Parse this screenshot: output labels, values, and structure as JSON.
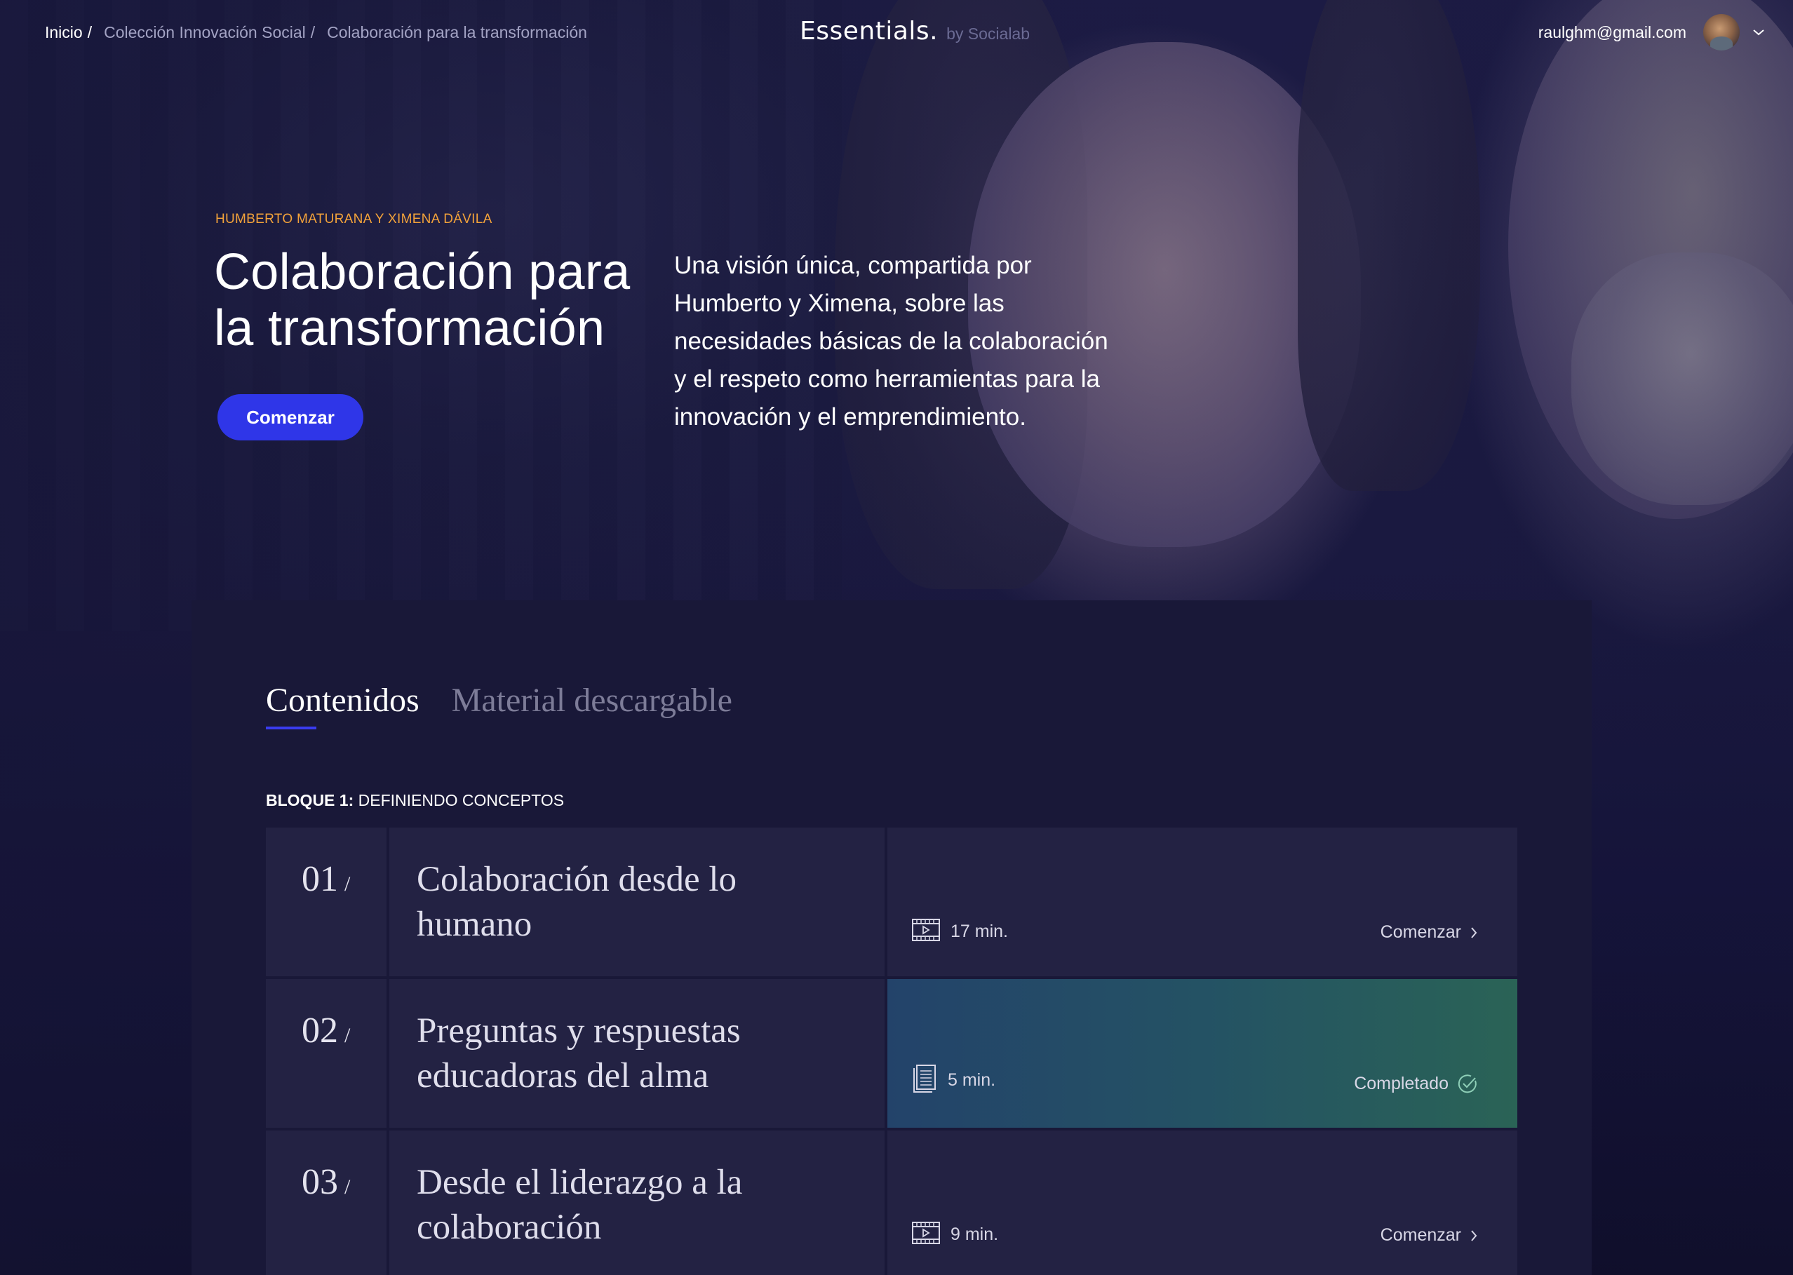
{
  "breadcrumb": {
    "items": [
      {
        "label": "Inicio"
      },
      {
        "label": "Colección Innovación Social"
      },
      {
        "label": "Colaboración para la transformación"
      }
    ],
    "separator": "/"
  },
  "brand": {
    "logo": "Essentials.",
    "byline": "by Socialab"
  },
  "user": {
    "email": "raulghm@gmail.com",
    "avatar_icon": "user-avatar",
    "menu_icon": "chevron-down-icon"
  },
  "hero": {
    "authors": "HUMBERTO MATURANA Y XIMENA DÁVILA",
    "title": "Colaboración para la transformación",
    "cta_label": "Comenzar",
    "description": "Una visión única, compartida por Humberto y Ximena, sobre las necesidades básicas de la colaboración y el respeto como herramientas para la innovación y el emprendimiento."
  },
  "tabs": [
    {
      "label": "Contenidos",
      "active": true
    },
    {
      "label": "Material descargable",
      "active": false
    }
  ],
  "block": {
    "prefix": "BLOQUE 1:",
    "name": "DEFINIENDO CONCEPTOS"
  },
  "lessons": [
    {
      "number": "01",
      "title": "Colaboración desde lo humano",
      "type_icon": "video-icon",
      "duration": "17 min.",
      "action": "Comenzar",
      "action_icon": "chevron-right-icon",
      "completed": false
    },
    {
      "number": "02",
      "title": "Preguntas y respuestas educadoras del alma",
      "type_icon": "document-icon",
      "duration": "5 min.",
      "action": "Completado",
      "action_icon": "check-circle-icon",
      "completed": true
    },
    {
      "number": "03",
      "title": "Desde el liderazgo a la colaboración",
      "type_icon": "video-icon",
      "duration": "9 min.",
      "action": "Comenzar",
      "action_icon": "chevron-right-icon",
      "completed": false
    }
  ],
  "colors": {
    "accent": "#2f36e8",
    "authors": "#f2a23a",
    "completed_start": "#23436a",
    "completed_end": "#2a6356"
  }
}
